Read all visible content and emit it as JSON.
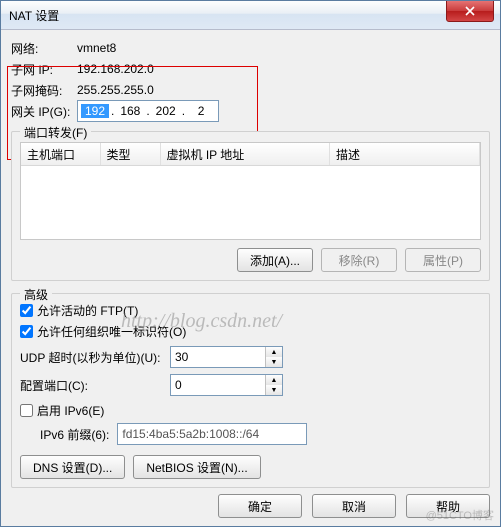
{
  "window": {
    "title": "NAT 设置"
  },
  "network": {
    "net_label": "网络:",
    "net_value": "vmnet8",
    "subnet_ip_label": "子网 IP:",
    "subnet_ip_value": "192.168.202.0",
    "subnet_mask_label": "子网掩码:",
    "subnet_mask_value": "255.255.255.0",
    "gateway_label": "网关 IP(G):",
    "gateway_oct1": "192",
    "gateway_oct2": "168",
    "gateway_oct3": "202",
    "gateway_oct4": "2"
  },
  "portforward": {
    "title": "端口转发(F)",
    "col_hostport": "主机端口",
    "col_type": "类型",
    "col_vmip": "虚拟机 IP 地址",
    "col_desc": "描述",
    "btn_add": "添加(A)...",
    "btn_remove": "移除(R)",
    "btn_props": "属性(P)"
  },
  "advanced": {
    "title": "高级",
    "allow_ftp_label": "允许活动的 FTP(T)",
    "allow_ftp_checked": true,
    "allow_oui_label": "允许任何组织唯一标识符(O)",
    "allow_oui_checked": true,
    "udp_label": "UDP 超时(以秒为单位)(U):",
    "udp_value": "30",
    "cfgport_label": "配置端口(C):",
    "cfgport_value": "0",
    "ipv6_enable_label": "启用 IPv6(E)",
    "ipv6_enable_checked": false,
    "ipv6_prefix_label": "IPv6 前缀(6):",
    "ipv6_prefix_value": "fd15:4ba5:5a2b:1008::/64",
    "btn_dns": "DNS 设置(D)...",
    "btn_netbios": "NetBIOS 设置(N)..."
  },
  "footer": {
    "ok": "确定",
    "cancel": "取消",
    "help": "帮助"
  },
  "watermark": "http://blog.csdn.net/",
  "corner_wm": "@51CTO博客"
}
